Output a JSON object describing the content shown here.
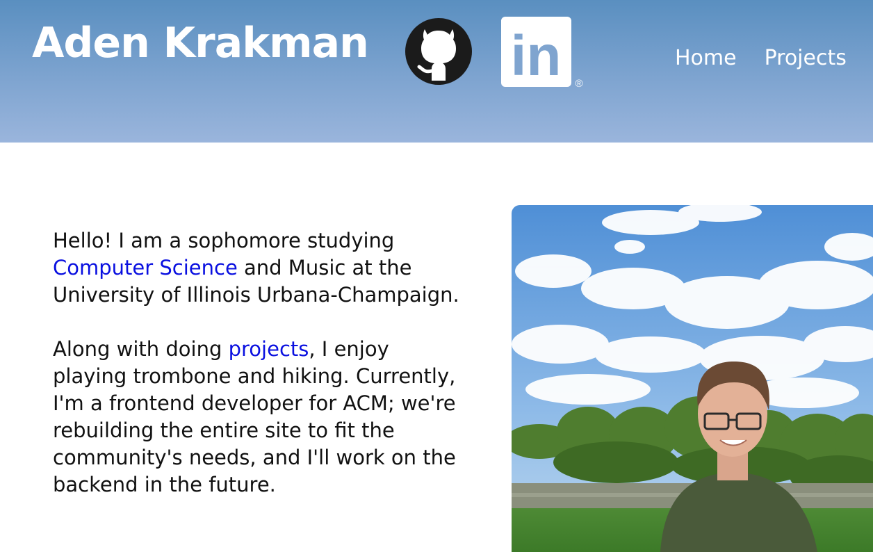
{
  "header": {
    "title": "Aden Krakman",
    "social": {
      "github_icon": "github-icon",
      "linkedin_icon": "linkedin-icon",
      "linkedin_text": "in",
      "linkedin_reg": "®"
    },
    "nav": {
      "home": "Home",
      "projects": "Projects"
    },
    "colors": {
      "gradient_top": "#5a8fc0",
      "gradient_bottom": "#9ab5dc"
    }
  },
  "bio": {
    "p1_start": "Hello! I am a sophomore studying ",
    "p1_link": "Computer Science",
    "p1_end": " and Music at the University of Illinois Urbana-Champaign.",
    "p2_start": "Along with doing ",
    "p2_link": "projects",
    "p2_end": ", I enjoy playing trombone and hiking. Currently, I'm a frontend developer for ACM; we're rebuilding the entire site to fit the community's needs, and I'll work on the backend in the future.",
    "link_color": "#0a10e0"
  },
  "photo": {
    "description_icon": "profile-photo"
  }
}
